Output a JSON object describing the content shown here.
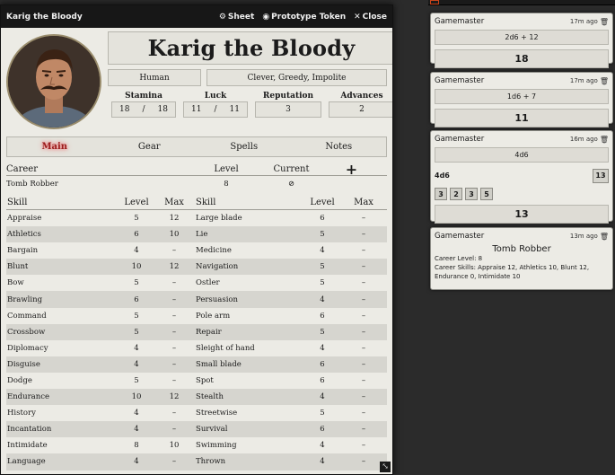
{
  "window": {
    "title": "Karig the Bloody",
    "buttons": {
      "sheet": "Sheet",
      "prototype_token": "Prototype Token",
      "close": "Close"
    }
  },
  "character": {
    "name": "Karig the Bloody",
    "species": "Human",
    "traits": "Clever, Greedy, Impolite",
    "stats": {
      "stamina": {
        "label": "Stamina",
        "current": "18",
        "sep": "/",
        "max": "18"
      },
      "luck": {
        "label": "Luck",
        "current": "11",
        "sep": "/",
        "max": "11"
      },
      "reputation": {
        "label": "Reputation",
        "value": "3"
      },
      "advances": {
        "label": "Advances",
        "value": "2"
      }
    }
  },
  "tabs": [
    "Main",
    "Gear",
    "Spells",
    "Notes"
  ],
  "career": {
    "headers": {
      "career": "Career",
      "level": "Level",
      "current": "Current",
      "add": "+"
    },
    "rows": [
      {
        "name": "Tomb Robber",
        "level": "8",
        "current_icon": "check-circle-icon",
        "current_glyph": "⊘"
      }
    ]
  },
  "skills": {
    "headers": {
      "skill": "Skill",
      "level": "Level",
      "max": "Max"
    },
    "left": [
      {
        "name": "Appraise",
        "level": "5",
        "max": "12"
      },
      {
        "name": "Athletics",
        "level": "6",
        "max": "10"
      },
      {
        "name": "Bargain",
        "level": "4",
        "max": "–"
      },
      {
        "name": "Blunt",
        "level": "10",
        "max": "12"
      },
      {
        "name": "Bow",
        "level": "5",
        "max": "–"
      },
      {
        "name": "Brawling",
        "level": "6",
        "max": "–"
      },
      {
        "name": "Command",
        "level": "5",
        "max": "–"
      },
      {
        "name": "Crossbow",
        "level": "5",
        "max": "–"
      },
      {
        "name": "Diplomacy",
        "level": "4",
        "max": "–"
      },
      {
        "name": "Disguise",
        "level": "4",
        "max": "–"
      },
      {
        "name": "Dodge",
        "level": "5",
        "max": "–"
      },
      {
        "name": "Endurance",
        "level": "10",
        "max": "12"
      },
      {
        "name": "History",
        "level": "4",
        "max": "–"
      },
      {
        "name": "Incantation",
        "level": "4",
        "max": "–"
      },
      {
        "name": "Intimidate",
        "level": "8",
        "max": "10"
      },
      {
        "name": "Language",
        "level": "4",
        "max": "–"
      }
    ],
    "right": [
      {
        "name": "Large blade",
        "level": "6",
        "max": "–"
      },
      {
        "name": "Lie",
        "level": "5",
        "max": "–"
      },
      {
        "name": "Medicine",
        "level": "4",
        "max": "–"
      },
      {
        "name": "Navigation",
        "level": "5",
        "max": "–"
      },
      {
        "name": "Ostler",
        "level": "5",
        "max": "–"
      },
      {
        "name": "Persuasion",
        "level": "4",
        "max": "–"
      },
      {
        "name": "Pole arm",
        "level": "6",
        "max": "–"
      },
      {
        "name": "Repair",
        "level": "5",
        "max": "–"
      },
      {
        "name": "Sleight of hand",
        "level": "4",
        "max": "–"
      },
      {
        "name": "Small blade",
        "level": "6",
        "max": "–"
      },
      {
        "name": "Spot",
        "level": "6",
        "max": "–"
      },
      {
        "name": "Stealth",
        "level": "4",
        "max": "–"
      },
      {
        "name": "Streetwise",
        "level": "5",
        "max": "–"
      },
      {
        "name": "Survival",
        "level": "6",
        "max": "–"
      },
      {
        "name": "Swimming",
        "level": "4",
        "max": "–"
      },
      {
        "name": "Thrown",
        "level": "4",
        "max": "–"
      }
    ]
  },
  "chat": [
    {
      "sender": "Gamemaster",
      "time": "17m ago",
      "formula": "2d6 + 12",
      "total": "18"
    },
    {
      "sender": "Gamemaster",
      "time": "17m ago",
      "formula": "1d6 + 7",
      "total": "11"
    },
    {
      "sender": "Gamemaster",
      "time": "16m ago",
      "formula": "4d6",
      "part_label": "4d6",
      "part_total": "13",
      "dice": [
        "3",
        "2",
        "3",
        "5"
      ],
      "total": "13"
    },
    {
      "sender": "Gamemaster",
      "time": "13m ago",
      "card_title": "Tomb Robber",
      "lines": [
        "Career Level: 8",
        "Career Skills: Appraise 12, Athletics 10, Blunt 12, Endurance 0, Intimidate 10"
      ]
    }
  ],
  "icons": {
    "sheet": "gear-icon",
    "token": "user-circle-icon",
    "close": "close-icon",
    "trash": "trash-icon",
    "resize": "resize-icon"
  },
  "colors": {
    "active_tab": "#9b1c1c",
    "accent_red": "#c8431a"
  }
}
